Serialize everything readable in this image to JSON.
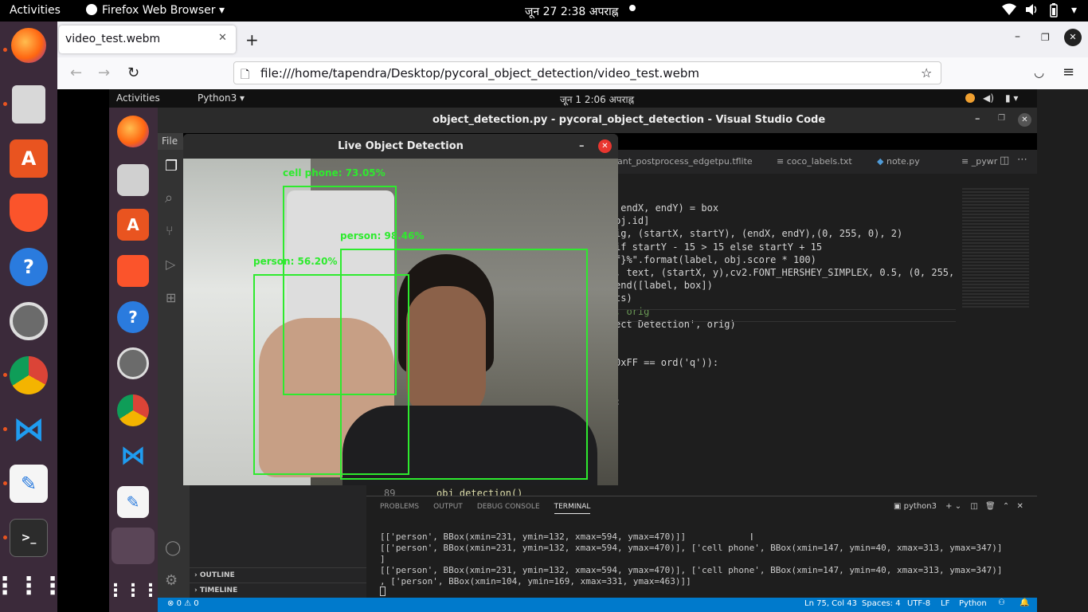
{
  "ubuntu_topbar": {
    "activities": "Activities",
    "app_menu": "Firefox Web Browser",
    "clock": "जून 27  2:38 अपराह्न"
  },
  "firefox": {
    "tab_title": "video_test.webm",
    "url": "file:///home/tapendra/Desktop/pycoral_object_detection/video_test.webm"
  },
  "inner_desktop": {
    "activities": "Activities",
    "app_menu": "Python3",
    "clock": "जून 1  2:06 अपराह्न"
  },
  "vscode": {
    "window_title": "object_detection.py - pycoral_object_detection - Visual Studio Code",
    "menu_file": "File",
    "tabs": [
      {
        "label": "ant_postprocess_edgetpu.tflite",
        "icon": "file-icon"
      },
      {
        "label": "coco_labels.txt",
        "icon": "list-icon"
      },
      {
        "label": "note.py",
        "icon": "python-icon"
      },
      {
        "label": "_pywr",
        "icon": "list-icon"
      }
    ],
    "code_lines": [
      {
        "text": " endX, endY) = box"
      },
      {
        "text": "bj.id]"
      },
      {
        "text": "ig, (startX, startY), (endX, endY),(0, 255, 0), 2)"
      },
      {
        "text": "if startY - 15 > 15 else startY + 15"
      },
      {
        "text": "f}%\".format(label, obj.score * 100)"
      },
      {
        "text": ", text, (startX, y),cv2.FONT_HERSHEY_SIMPLEX, 0.5, (0, 255,"
      },
      {
        "text": "end([label, box])"
      },
      {
        "text": "ts)"
      },
      {
        "text": ", orig"
      },
      {
        "text": "ect Detection', orig)"
      },
      {
        "text": ""
      },
      {
        "text": ""
      },
      {
        "text": "0xFF == ord('q')):"
      },
      {
        "text": ""
      },
      {
        "text": ""
      },
      {
        "text": ":"
      }
    ],
    "bottom_line_number": "89",
    "bottom_line_code": "obj_detection()",
    "sidebar_sections": [
      "OUTLINE",
      "TIMELINE"
    ],
    "panel_tabs": [
      "PROBLEMS",
      "OUTPUT",
      "DEBUG CONSOLE",
      "TERMINAL"
    ],
    "panel_active_tab": "TERMINAL",
    "terminal_name": "python3",
    "terminal_lines": [
      "[['person', BBox(xmin=231, ymin=132, xmax=594, ymax=470)]]",
      "[['person', BBox(xmin=231, ymin=132, xmax=594, ymax=470)], ['cell phone', BBox(xmin=147, ymin=40, xmax=313, ymax=347)]",
      "]",
      "[['person', BBox(xmin=231, ymin=132, xmax=594, ymax=470)], ['cell phone', BBox(xmin=147, ymin=40, xmax=313, ymax=347)]",
      ", ['person', BBox(xmin=104, ymin=169, xmax=331, ymax=463)]]"
    ],
    "status": {
      "errors": "0",
      "warnings": "0",
      "position": "Ln 75, Col 43",
      "spaces": "Spaces: 4",
      "encoding": "UTF-8",
      "eol": "LF",
      "language": "Python"
    }
  },
  "detection_window": {
    "title": "Live Object Detection",
    "detections": [
      {
        "label": "cell phone: 73.05%"
      },
      {
        "label": "person: 98.46%"
      },
      {
        "label": "person: 56.20%"
      }
    ]
  }
}
